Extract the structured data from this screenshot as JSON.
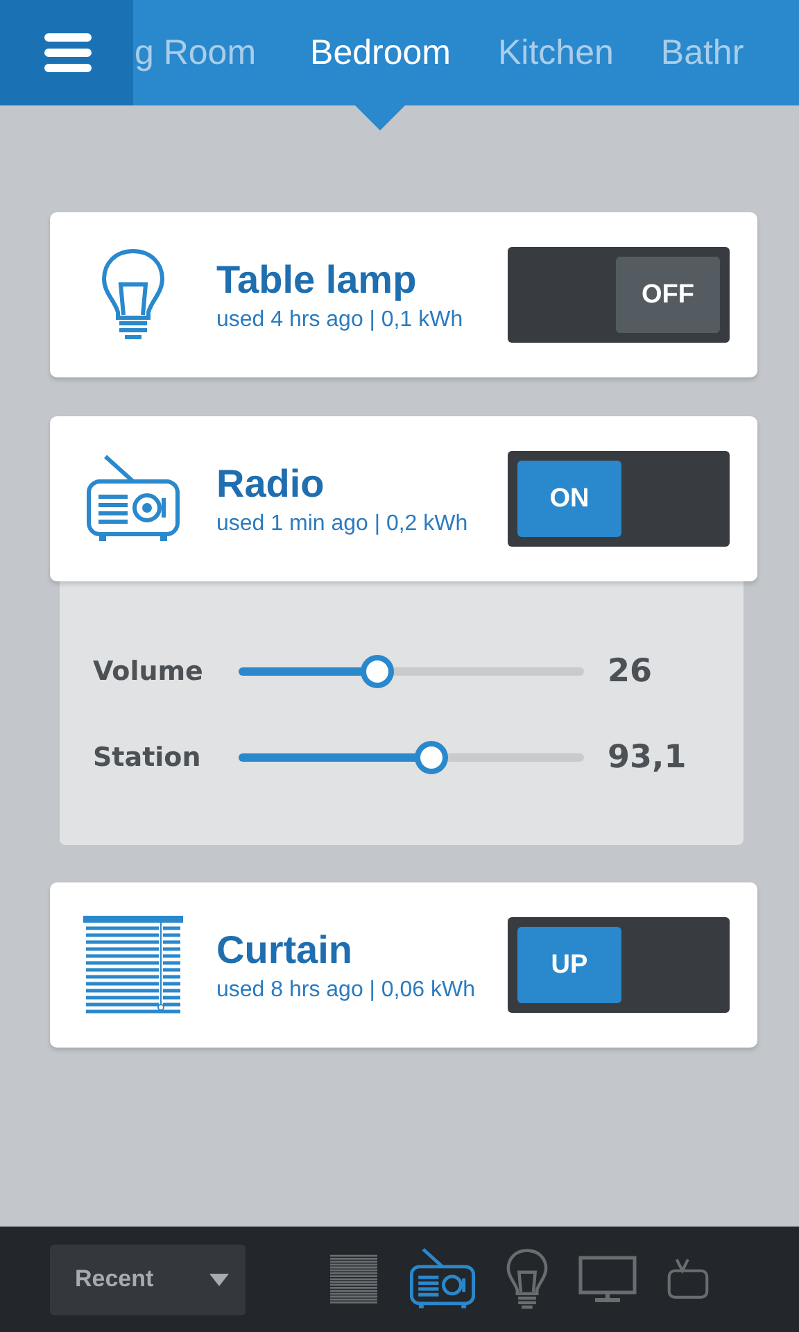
{
  "tabs": [
    {
      "label": "g Room",
      "selected": false
    },
    {
      "label": "Bedroom",
      "selected": true
    },
    {
      "label": "Kitchen",
      "selected": false
    },
    {
      "label": "Bathr",
      "selected": false
    }
  ],
  "devices": [
    {
      "kind": "lamp",
      "name": "Table lamp",
      "usage": "used 4 hrs ago | 0,1 kWh",
      "switch": {
        "label": "OFF",
        "on": false
      }
    },
    {
      "kind": "radio",
      "name": "Radio",
      "usage": "used 1 min ago | 0,2 kWh",
      "switch": {
        "label": "ON",
        "on": true
      },
      "controls": [
        {
          "label": "Volume",
          "level": 0.4,
          "reading": "26"
        },
        {
          "label": "Station",
          "level": 0.56,
          "reading": "93,1"
        }
      ]
    },
    {
      "kind": "curtain",
      "name": "Curtain",
      "usage": "used 8 hrs ago | 0,06 kWh",
      "switch": {
        "label": "UP",
        "on": true
      }
    }
  ],
  "bottom_bar": {
    "filter": "Recent",
    "devices": [
      {
        "kind": "curtain",
        "selected": false
      },
      {
        "kind": "radio",
        "selected": true
      },
      {
        "kind": "lamp",
        "selected": false
      },
      {
        "kind": "monitor",
        "selected": false
      },
      {
        "kind": "tv",
        "selected": false
      }
    ]
  }
}
